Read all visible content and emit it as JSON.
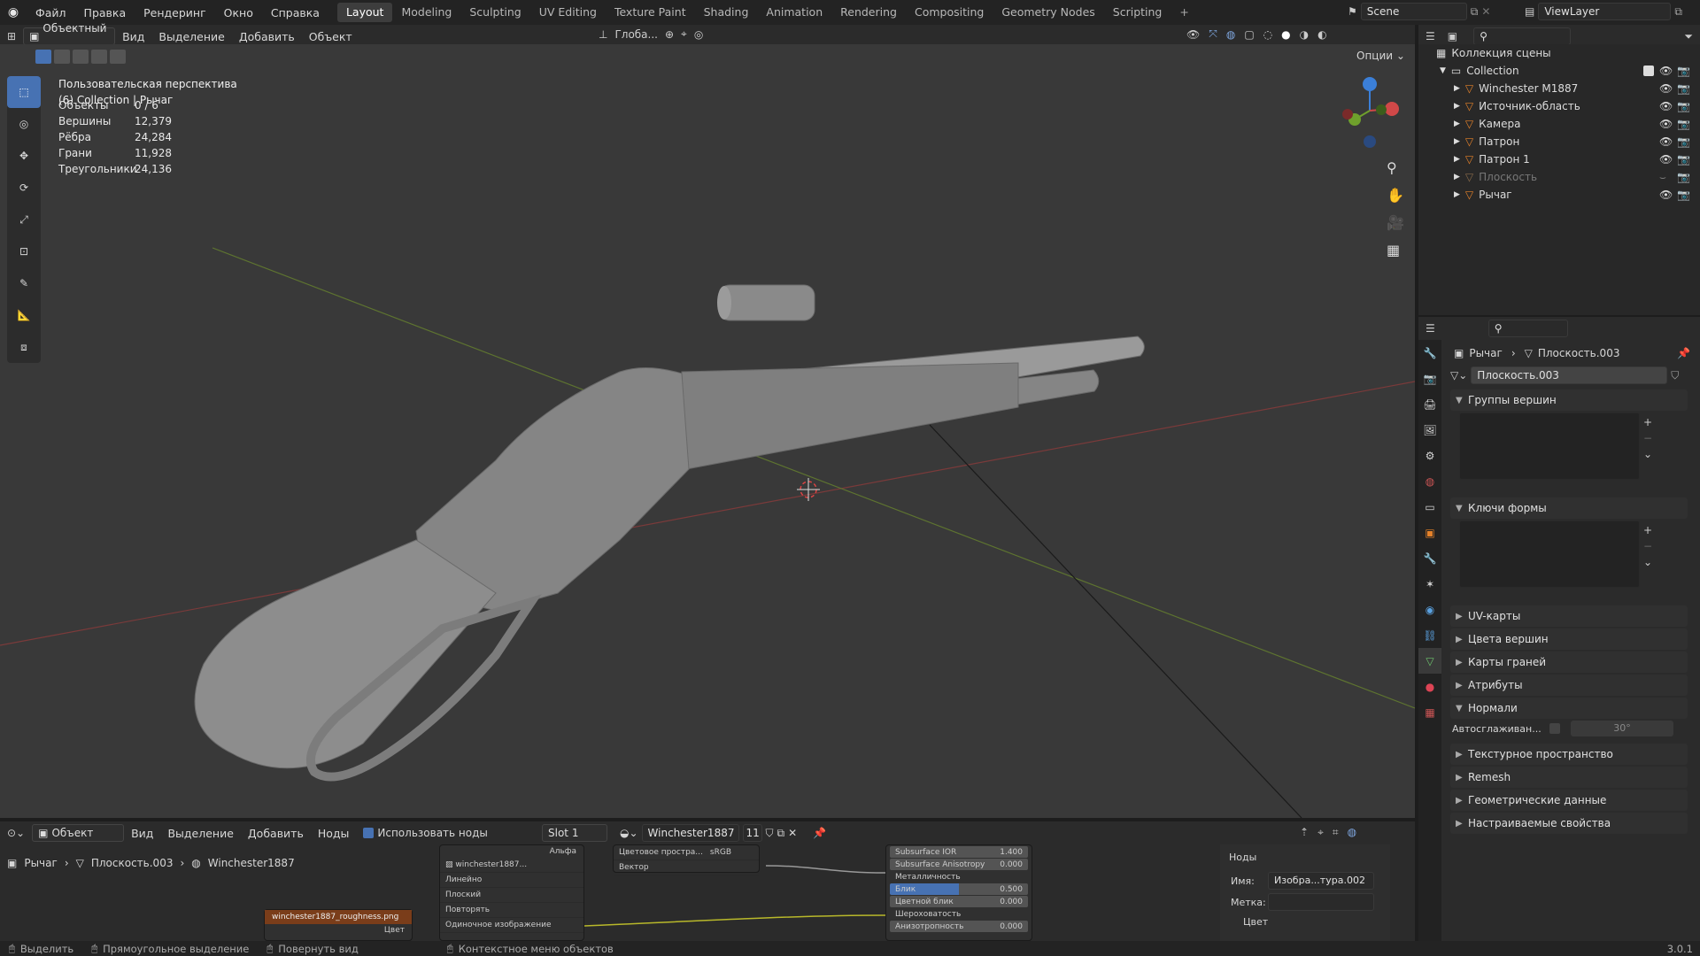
{
  "app": {
    "version": "3.0.1"
  },
  "menu": [
    "Файл",
    "Правка",
    "Рендеринг",
    "Окно",
    "Справка"
  ],
  "workspaces": [
    "Layout",
    "Modeling",
    "Sculpting",
    "UV Editing",
    "Texture Paint",
    "Shading",
    "Animation",
    "Rendering",
    "Compositing",
    "Geometry Nodes",
    "Scripting"
  ],
  "active_workspace": "Layout",
  "scene": {
    "name": "Scene",
    "view_layer": "ViewLayer"
  },
  "viewport": {
    "mode": "Объектный ...",
    "menus": [
      "Вид",
      "Выделение",
      "Добавить",
      "Объект"
    ],
    "orientation": "Глоба...",
    "options": "Опции",
    "title": "Пользовательская перспектива",
    "subtitle": "(6) Collection | Рычаг",
    "stats": [
      {
        "label": "Объекты",
        "value": "0 / 6"
      },
      {
        "label": "Вершины",
        "value": "12,379"
      },
      {
        "label": "Рёбра",
        "value": "24,284"
      },
      {
        "label": "Грани",
        "value": "11,928"
      },
      {
        "label": "Треугольники",
        "value": "24,136"
      }
    ]
  },
  "outliner": {
    "root": "Коллекция сцены",
    "collection": "Collection",
    "items": [
      {
        "name": "Winchester M1887",
        "color": "#e5822a",
        "hidden": false
      },
      {
        "name": "Источник-область",
        "color": "#e5822a",
        "hidden": false
      },
      {
        "name": "Камера",
        "color": "#e5822a",
        "hidden": false
      },
      {
        "name": "Патрон",
        "color": "#e5822a",
        "hidden": false
      },
      {
        "name": "Патрон 1",
        "color": "#e5822a",
        "hidden": false
      },
      {
        "name": "Плоскость",
        "color": "#8a6a4a",
        "hidden": true
      },
      {
        "name": "Рычаг",
        "color": "#e5822a",
        "hidden": false
      }
    ]
  },
  "properties": {
    "breadcrumb_object": "Рычаг",
    "breadcrumb_data": "Плоскость.003",
    "mesh_name": "Плоскость.003",
    "panels": [
      {
        "label": "Группы вершин",
        "open": true
      },
      {
        "label": "Ключи формы",
        "open": true
      },
      {
        "label": "UV-карты",
        "open": false
      },
      {
        "label": "Цвета вершин",
        "open": false
      },
      {
        "label": "Карты граней",
        "open": false
      },
      {
        "label": "Атрибуты",
        "open": false
      },
      {
        "label": "Нормали",
        "open": true
      },
      {
        "label": "Текстурное пространство",
        "open": false
      },
      {
        "label": "Remesh",
        "open": false
      },
      {
        "label": "Геометрические данные",
        "open": false
      },
      {
        "label": "Настраиваемые свойства",
        "open": false
      }
    ],
    "autosmooth_label": "Автосглаживан...",
    "autosmooth_angle": "30°"
  },
  "node_editor": {
    "mode": "Объект",
    "menus": [
      "Вид",
      "Выделение",
      "Добавить",
      "Ноды"
    ],
    "use_nodes": "Использовать ноды",
    "slot": "Slot 1",
    "material": "Winchester1887",
    "users": "11",
    "breadcrumb": [
      "Рычаг",
      "Плоскость.003",
      "Winchester1887"
    ],
    "image_node": "winchester1887_roughness.png",
    "image_output": "Цвет",
    "tex_node": {
      "alpha": "Альфа",
      "image": "winchester1887...",
      "rows": [
        "Линейно",
        "Плоский",
        "Повторять",
        "Одиночное изображение"
      ]
    },
    "cs_node": {
      "label": "Цветовое простра...",
      "value": "sRGB",
      "vector": "Вектор"
    },
    "bsdf_rows": [
      {
        "label": "Subsurface IOR",
        "value": "1.400"
      },
      {
        "label": "Subsurface Anisotropy",
        "value": "0.000"
      },
      {
        "label": "Металличность",
        "value": ""
      },
      {
        "label": "Блик",
        "value": "0.500",
        "fill": 0.5
      },
      {
        "label": "Цветной блик",
        "value": "0.000"
      },
      {
        "label": "Шероховатость",
        "value": ""
      },
      {
        "label": "Анизотропность",
        "value": "0.000"
      }
    ],
    "side": {
      "title": "Ноды",
      "name_label": "Имя:",
      "name_value": "Изобра...тура.002",
      "label_label": "Метка:",
      "color_label": "Цвет"
    }
  },
  "status": [
    "Выделить",
    "Прямоугольное выделение",
    "Повернуть вид",
    "Контекстное меню объектов"
  ]
}
